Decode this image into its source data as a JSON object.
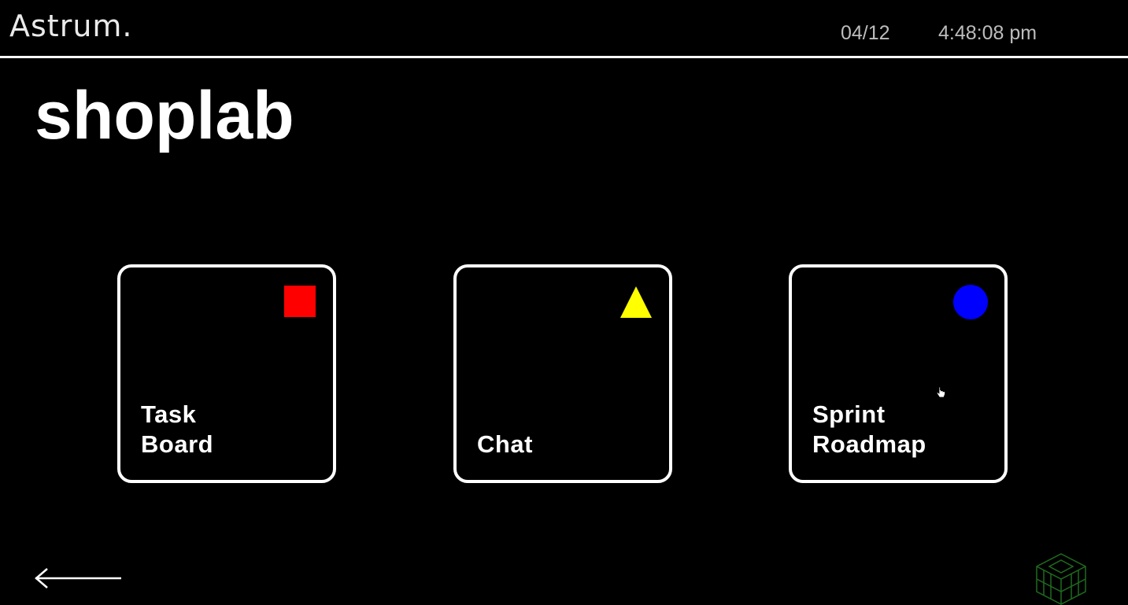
{
  "header": {
    "brand": "Astrum.",
    "date": "04/12",
    "time": "4:48:08 pm"
  },
  "page": {
    "title": "shoplab"
  },
  "tiles": [
    {
      "label": "Task\nBoard",
      "icon": "square-icon",
      "color": "#ff0000"
    },
    {
      "label": "Chat",
      "icon": "triangle-icon",
      "color": "#ffff00"
    },
    {
      "label": "Sprint\nRoadmap",
      "icon": "circle-icon",
      "color": "#0000ff"
    }
  ],
  "nav": {
    "back_icon": "left-arrow-icon"
  },
  "branding": {
    "corner_logo_icon": "cube-logo-icon",
    "corner_logo_color": "#1f6b1f"
  }
}
